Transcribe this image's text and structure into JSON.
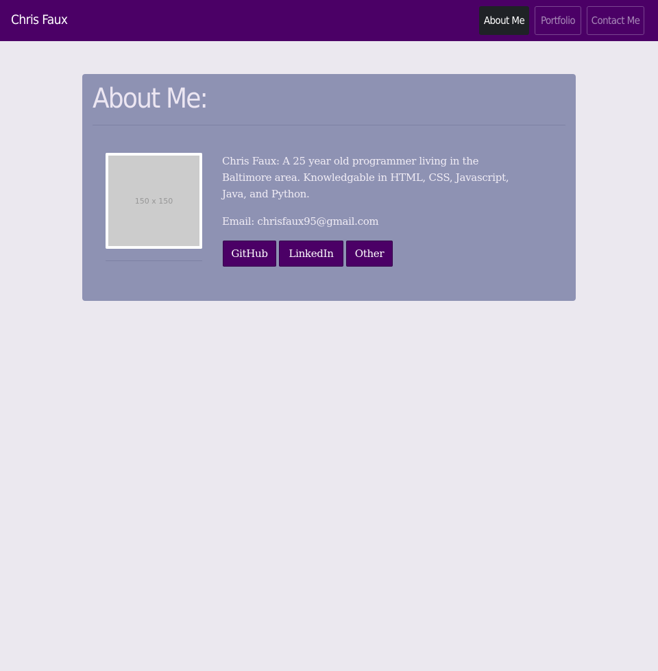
{
  "navbar": {
    "brand": "Chris Faux",
    "links": [
      {
        "label": "About Me",
        "active": true
      },
      {
        "label": "Portfolio",
        "active": false
      },
      {
        "label": "Contact Me",
        "active": false
      }
    ]
  },
  "about": {
    "heading": "About Me:",
    "photo_placeholder": "150 x 150",
    "bio": "Chris Faux: A 25 year old programmer living in the Baltimore area. Knowledgable in HTML, CSS, Javascript, Java, and Python.",
    "email": "Email: chrisfaux95@gmail.com",
    "buttons": [
      {
        "label": "GitHub"
      },
      {
        "label": "LinkedIn"
      },
      {
        "label": "Other"
      }
    ]
  },
  "colors": {
    "navbar_bg": "#4b0066",
    "page_bg": "#ebe8ef",
    "card_bg": "#8e92b3",
    "active_nav_bg": "#1f2226",
    "button_bg": "#4b0066"
  }
}
